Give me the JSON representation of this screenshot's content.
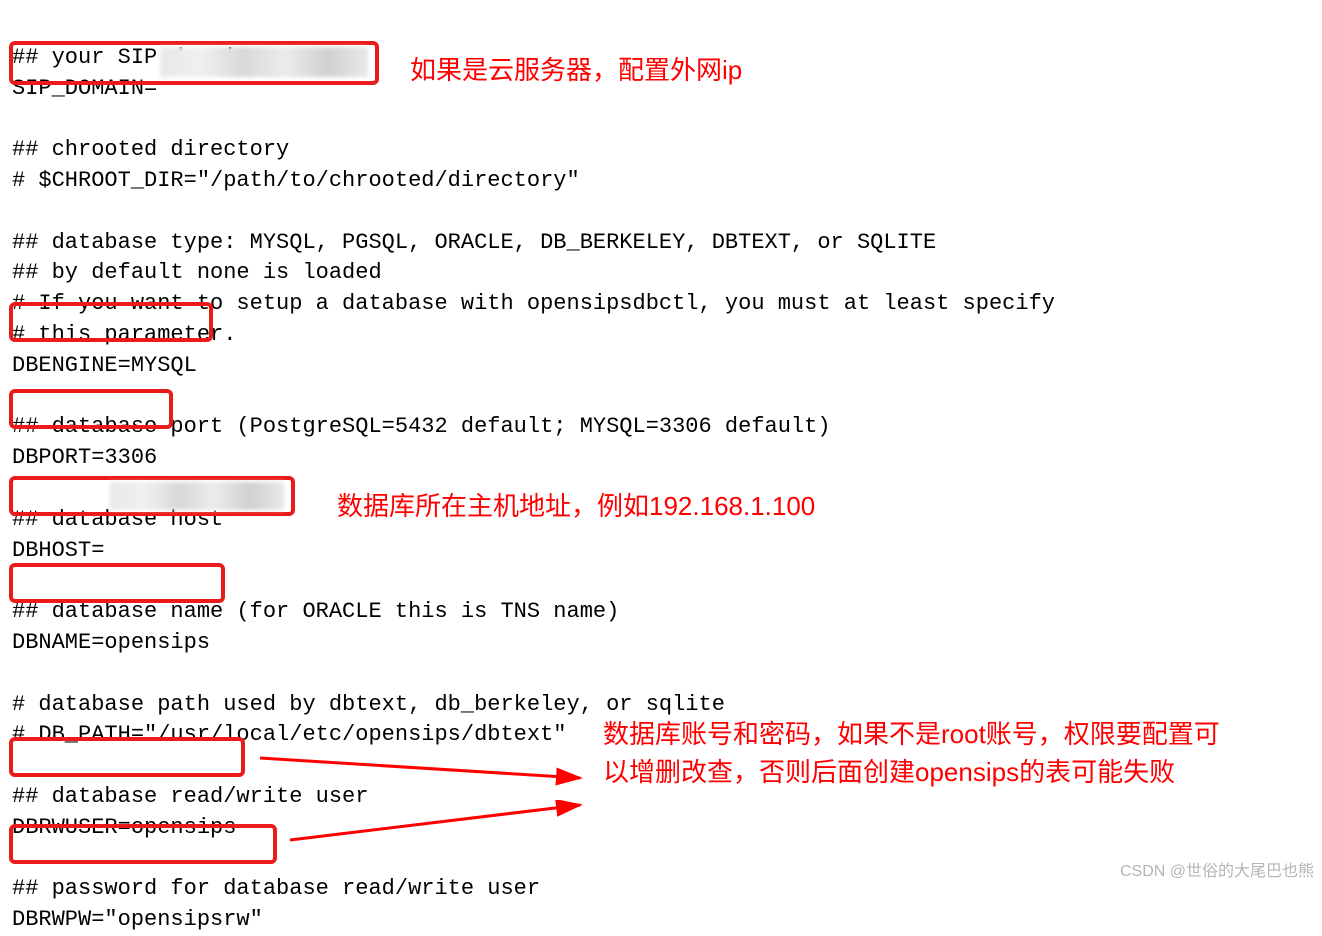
{
  "code": {
    "l01": "## your SIP domain",
    "l02": "SIP_DOMAIN=",
    "l03": "",
    "l04": "## chrooted directory",
    "l05": "# $CHROOT_DIR=\"/path/to/chrooted/directory\"",
    "l06": "",
    "l07": "## database type: MYSQL, PGSQL, ORACLE, DB_BERKELEY, DBTEXT, or SQLITE",
    "l08": "## by default none is loaded",
    "l09": "# If you want to setup a database with opensipsdbctl, you must at least specify",
    "l10": "# this parameter.",
    "l11": "DBENGINE=MYSQL",
    "l12": "",
    "l13": "## database port (PostgreSQL=5432 default; MYSQL=3306 default)",
    "l14": "DBPORT=3306",
    "l15": "",
    "l16": "## database host",
    "l17": "DBHOST=",
    "l18": "",
    "l19": "## database name (for ORACLE this is TNS name)",
    "l20": "DBNAME=opensips",
    "l21": "",
    "l22": "# database path used by dbtext, db_berkeley, or sqlite",
    "l23": "# DB_PATH=\"/usr/local/etc/opensips/dbtext\"",
    "l24": "",
    "l25": "## database read/write user",
    "l26": "DBRWUSER=opensips",
    "l27": "",
    "l28": "## password for database read/write user",
    "l29": "DBRWPW=\"opensipsrw\""
  },
  "annotations": {
    "a1": "如果是云服务器，配置外网ip",
    "a2": "数据库所在主机地址，例如192.168.1.100",
    "a3": "数据库账号和密码，如果不是root账号，权限要配置可以增删改查，否则后面创建opensips的表可能失败"
  },
  "watermark": "CSDN @世俗的大尾巴也熊"
}
